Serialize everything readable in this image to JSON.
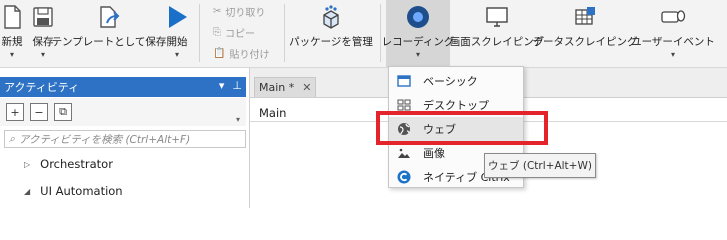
{
  "ribbon": {
    "new_label": "新規",
    "save_label": "保存",
    "save_as_template_label": "テンプレートとして保存",
    "start_label": "開始",
    "cut_label": "切り取り",
    "copy_label": "コピー",
    "paste_label": "貼り付け",
    "manage_packages_label": "パッケージを管理",
    "recording_label": "レコーディング",
    "screen_scraping_label": "画面スクレイピング",
    "data_scraping_label": "データスクレイピング",
    "user_events_label": "ユーザーイベント"
  },
  "activities_panel": {
    "title": "アクティビティ",
    "search_placeholder": "アクティビティを検索 (Ctrl+Alt+F)",
    "tree": [
      "Orchestrator",
      "UI Automation"
    ]
  },
  "document": {
    "tab_label": "Main *",
    "title": "Main"
  },
  "recording_menu": {
    "items": [
      {
        "label": "ベーシック",
        "icon": "basic-recorder-icon"
      },
      {
        "label": "デスクトップ",
        "icon": "desktop-recorder-icon"
      },
      {
        "label": "ウェブ",
        "icon": "globe-icon"
      },
      {
        "label": "画像",
        "icon": "image-recorder-icon"
      },
      {
        "label": "ネイティブ Citrix",
        "icon": "citrix-icon"
      }
    ]
  },
  "tooltip": "ウェブ (Ctrl+Alt+W)",
  "colors": {
    "accent_blue": "#2d72c4",
    "highlight_red": "#e4242b"
  }
}
